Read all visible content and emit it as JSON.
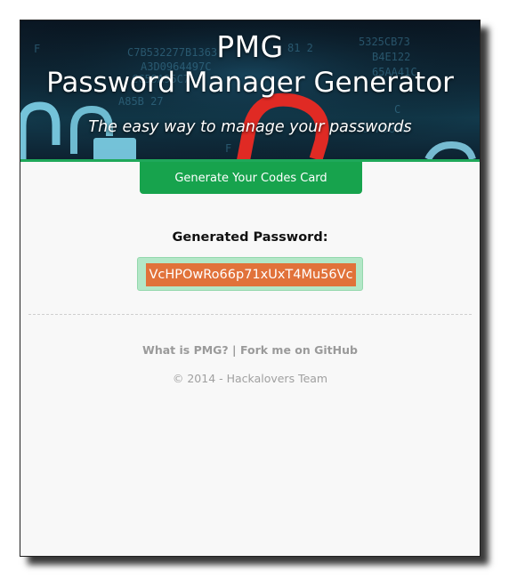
{
  "header": {
    "title_short": "PMG",
    "title_full": "Password Manager Generator",
    "tagline": "The easy way to manage your passwords"
  },
  "actions": {
    "generate_button": "Generate Your Codes Card"
  },
  "result": {
    "label": "Generated Password:",
    "password": "VcHPOwRo66p71xUxT4Mu56Vc"
  },
  "footer": {
    "link_about": "What is PMG?",
    "separator": " | ",
    "link_github": "Fork me on GitHub",
    "copyright": "© 2014 - Hackalovers Team"
  },
  "colors": {
    "accent_green": "#17a34d",
    "password_highlight": "#e1723a",
    "password_box": "#b3e7c7"
  },
  "icons": [
    "padlock-illustration"
  ]
}
